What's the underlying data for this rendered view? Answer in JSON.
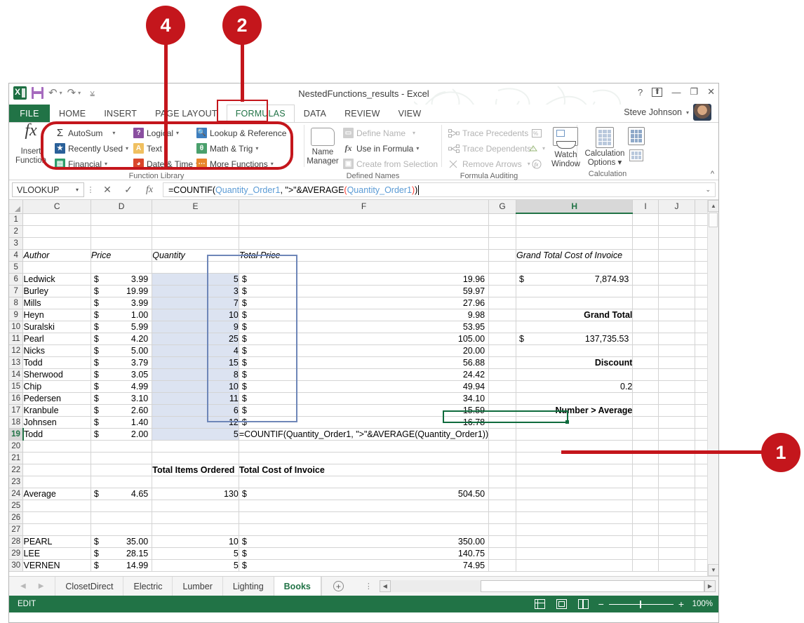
{
  "window": {
    "title": "NestedFunctions_results - Excel",
    "user": "Steve Johnson",
    "help_icon": "?",
    "ribbon_display_icon": "ribbon-display-options",
    "minimize_icon": "–",
    "restore_icon": "restore",
    "close_icon": "✕"
  },
  "quick_access": {
    "save_label": "Save",
    "undo_label": "Undo",
    "redo_label": "Redo",
    "customize_label": "Customize Quick Access Toolbar"
  },
  "ribbon": {
    "tabs": [
      {
        "label": "FILE"
      },
      {
        "label": "HOME"
      },
      {
        "label": "INSERT"
      },
      {
        "label": "PAGE LAYOUT"
      },
      {
        "label": "FORMULAS"
      },
      {
        "label": "DATA"
      },
      {
        "label": "REVIEW"
      },
      {
        "label": "VIEW"
      }
    ],
    "active_tab": "FORMULAS",
    "collapse_icon": "^",
    "groups": [
      {
        "name": "Function Library",
        "big_button": {
          "line1": "Insert",
          "line2": "Function",
          "icon": "fx"
        },
        "items": [
          {
            "label": "AutoSum",
            "icon": "sigma-icon",
            "caret": "▾"
          },
          {
            "label": "Recently Used",
            "icon": "star-icon",
            "caret": "▾"
          },
          {
            "label": "Financial",
            "icon": "financial-icon",
            "caret": "▾"
          },
          {
            "label": "Logical",
            "icon": "logical-icon",
            "caret": "▾"
          },
          {
            "label": "Text",
            "icon": "text-icon",
            "caret": "▾"
          },
          {
            "label": "Date & Time",
            "icon": "clock-icon",
            "caret": "▾"
          },
          {
            "label": "Lookup & Reference",
            "icon": "lookup-icon",
            "caret": "▾"
          },
          {
            "label": "Math & Trig",
            "icon": "math-icon",
            "caret": "▾"
          },
          {
            "label": "More Functions",
            "icon": "more-functions-icon",
            "caret": "▾"
          }
        ]
      },
      {
        "name": "Defined Names",
        "big_button": {
          "line1": "Name",
          "line2": "Manager",
          "icon": "name-manager-icon"
        },
        "items": [
          {
            "label": "Define Name",
            "icon": "define-name-icon",
            "caret": "▾"
          },
          {
            "label": "Use in Formula",
            "icon": "use-in-formula-icon",
            "caret": "▾"
          },
          {
            "label": "Create from Selection",
            "icon": "create-from-selection-icon",
            "caret": ""
          }
        ]
      },
      {
        "name": "Formula Auditing",
        "items": [
          {
            "label": "Trace Precedents",
            "icon": "trace-precedents-icon"
          },
          {
            "label": "Trace Dependents",
            "icon": "trace-dependents-icon"
          },
          {
            "label": "Remove Arrows",
            "icon": "remove-arrows-icon",
            "caret": "▾"
          }
        ],
        "extras": [
          {
            "label": "Show Formulas",
            "icon": "show-formulas-icon"
          },
          {
            "label": "Error Checking",
            "icon": "error-checking-icon",
            "caret": "▾"
          },
          {
            "label": "Evaluate Formula",
            "icon": "evaluate-formula-icon"
          }
        ],
        "watch": {
          "line1": "Watch",
          "line2": "Window"
        }
      },
      {
        "name": "Calculation",
        "big_button": {
          "line1": "Calculation",
          "line2": "Options ▾",
          "icon": "calculation-options-icon"
        },
        "extras": [
          {
            "label": "Calculate Now",
            "icon": "calculate-now-icon"
          },
          {
            "label": "Calculate Sheet",
            "icon": "calculate-sheet-icon"
          }
        ]
      }
    ]
  },
  "formula_bar": {
    "name_box": "VLOOKUP",
    "name_box_caret": "▾",
    "cancel_icon": "✕",
    "enter_icon": "✓",
    "insert_function_icon": "fx",
    "formula_parts": [
      {
        "text": "=COUNTIF(",
        "color": "black"
      },
      {
        "text": "Quantity_Order1",
        "color": "blue"
      },
      {
        "text": ", \">\"&AVERAGE",
        "color": "black"
      },
      {
        "text": "(",
        "color": "red"
      },
      {
        "text": "Quantity_Order1",
        "color": "blue"
      },
      {
        "text": ")",
        "color": "red"
      },
      {
        "text": ")",
        "color": "black"
      }
    ],
    "formula_plain": "=COUNTIF(Quantity_Order1, \">\"&AVERAGE(Quantity_Order1))",
    "expand_icon": "⌄"
  },
  "grid": {
    "columns": [
      "C",
      "D",
      "E",
      "F",
      "G",
      "H",
      "I",
      "J"
    ],
    "selected_column": "H",
    "rows": [
      {
        "num": "1",
        "C": "",
        "D": "",
        "E": "",
        "F": "",
        "G": "",
        "H": "",
        "I": "",
        "J": ""
      },
      {
        "num": "2",
        "C": "",
        "D": "",
        "E": "",
        "F": "",
        "G": "",
        "H": "",
        "I": "",
        "J": ""
      },
      {
        "num": "3",
        "C": "",
        "D": "",
        "E": "",
        "F": "",
        "G": "",
        "H": "",
        "I": "",
        "J": ""
      },
      {
        "num": "4",
        "C": "Author",
        "D": "Price",
        "E": "Quantity",
        "F": "Total Price",
        "G": "",
        "H": "Grand Total Cost of Invoice",
        "I": "",
        "J": ""
      },
      {
        "num": "5",
        "C": "",
        "D": "",
        "E": "",
        "F": "",
        "G": "",
        "H": "",
        "I": "",
        "J": ""
      },
      {
        "num": "6",
        "C": "Ledwick",
        "D": "3.99",
        "E": "5",
        "F": "19.96",
        "G": "",
        "H": "7,874.93",
        "I": "",
        "J": ""
      },
      {
        "num": "7",
        "C": "Burley",
        "D": "19.99",
        "E": "3",
        "F": "59.97",
        "G": "",
        "H": "",
        "I": "",
        "J": ""
      },
      {
        "num": "8",
        "C": "Mills",
        "D": "3.99",
        "E": "7",
        "F": "27.96",
        "G": "",
        "H": "",
        "I": "",
        "J": ""
      },
      {
        "num": "9",
        "C": "Heyn",
        "D": "1.00",
        "E": "10",
        "F": "9.98",
        "G": "",
        "H": "Grand Total",
        "I": "",
        "J": ""
      },
      {
        "num": "10",
        "C": "Suralski",
        "D": "5.99",
        "E": "9",
        "F": "53.95",
        "G": "",
        "H": "",
        "I": "",
        "J": ""
      },
      {
        "num": "11",
        "C": "Pearl",
        "D": "4.20",
        "E": "25",
        "F": "105.00",
        "G": "",
        "H": "137,735.53",
        "I": "",
        "J": ""
      },
      {
        "num": "12",
        "C": "Nicks",
        "D": "5.00",
        "E": "4",
        "F": "20.00",
        "G": "",
        "H": "",
        "I": "",
        "J": ""
      },
      {
        "num": "13",
        "C": "Todd",
        "D": "3.79",
        "E": "15",
        "F": "56.88",
        "G": "",
        "H": "Discount",
        "I": "",
        "J": ""
      },
      {
        "num": "14",
        "C": "Sherwood",
        "D": "3.05",
        "E": "8",
        "F": "24.42",
        "G": "",
        "H": "",
        "I": "",
        "J": ""
      },
      {
        "num": "15",
        "C": "Chip",
        "D": "4.99",
        "E": "10",
        "F": "49.94",
        "G": "",
        "H": "0.2",
        "I": "",
        "J": ""
      },
      {
        "num": "16",
        "C": "Pedersen",
        "D": "3.10",
        "E": "11",
        "F": "34.10",
        "G": "",
        "H": "",
        "I": "",
        "J": ""
      },
      {
        "num": "17",
        "C": "Kranbule",
        "D": "2.60",
        "E": "6",
        "F": "15.59",
        "G": "",
        "H": "Number > Average",
        "I": "",
        "J": ""
      },
      {
        "num": "18",
        "C": "Johnsen",
        "D": "1.40",
        "E": "12",
        "F": "16.78",
        "G": "",
        "H": "",
        "I": "",
        "J": ""
      },
      {
        "num": "19",
        "C": "Todd",
        "D": "2.00",
        "E": "5",
        "F": "",
        "G": "",
        "H": "",
        "I": "",
        "J": ""
      },
      {
        "num": "20",
        "C": "",
        "D": "",
        "E": "",
        "F": "",
        "G": "",
        "H": "",
        "I": "",
        "J": ""
      },
      {
        "num": "21",
        "C": "",
        "D": "",
        "E": "",
        "F": "",
        "G": "",
        "H": "",
        "I": "",
        "J": ""
      },
      {
        "num": "22",
        "C": "",
        "D": "",
        "E": "Total Items Ordered",
        "F": "Total Cost of Invoice",
        "G": "",
        "H": "",
        "I": "",
        "J": ""
      },
      {
        "num": "23",
        "C": "",
        "D": "",
        "E": "",
        "F": "",
        "G": "",
        "H": "",
        "I": "",
        "J": ""
      },
      {
        "num": "24",
        "C": "Average",
        "D": "4.65",
        "E": "130",
        "F": "504.50",
        "G": "",
        "H": "",
        "I": "",
        "J": ""
      },
      {
        "num": "25",
        "C": "",
        "D": "",
        "E": "",
        "F": "",
        "G": "",
        "H": "",
        "I": "",
        "J": ""
      },
      {
        "num": "26",
        "C": "",
        "D": "",
        "E": "",
        "F": "",
        "G": "",
        "H": "",
        "I": "",
        "J": ""
      },
      {
        "num": "27",
        "C": "",
        "D": "",
        "E": "",
        "F": "",
        "G": "",
        "H": "",
        "I": "",
        "J": ""
      },
      {
        "num": "28",
        "C": "PEARL",
        "D": "35.00",
        "E": "10",
        "F": "350.00",
        "G": "",
        "H": "",
        "I": "",
        "J": ""
      },
      {
        "num": "29",
        "C": "LEE",
        "D": "28.15",
        "E": "5",
        "F": "140.75",
        "G": "",
        "H": "",
        "I": "",
        "J": ""
      },
      {
        "num": "30",
        "C": "VERNEN",
        "D": "14.99",
        "E": "5",
        "F": "74.95",
        "G": "",
        "H": "",
        "I": "",
        "J": ""
      }
    ],
    "editing_cell_formula": "=COUNTIF(Quantity_Order1, \">\"&AVERAGE(Quantity_Order1))",
    "dollar_sign": "$"
  },
  "sheet_tabs": {
    "tabs": [
      "ClosetDirect",
      "Electric",
      "Lumber",
      "Lighting",
      "Books"
    ],
    "active": "Books",
    "prev_icon": "◀",
    "next_icon": "▶",
    "add_icon": "+",
    "split_icon": "⋮"
  },
  "status_bar": {
    "mode": "EDIT",
    "view_normal_icon": "normal-view-icon",
    "view_pagelayout_icon": "page-layout-view-icon",
    "view_pagebreak_icon": "page-break-view-icon",
    "zoom_out_icon": "−",
    "zoom_in_icon": "+",
    "zoom_level": "100%"
  },
  "callouts": [
    {
      "number": "4"
    },
    {
      "number": "2"
    },
    {
      "number": "1"
    }
  ]
}
